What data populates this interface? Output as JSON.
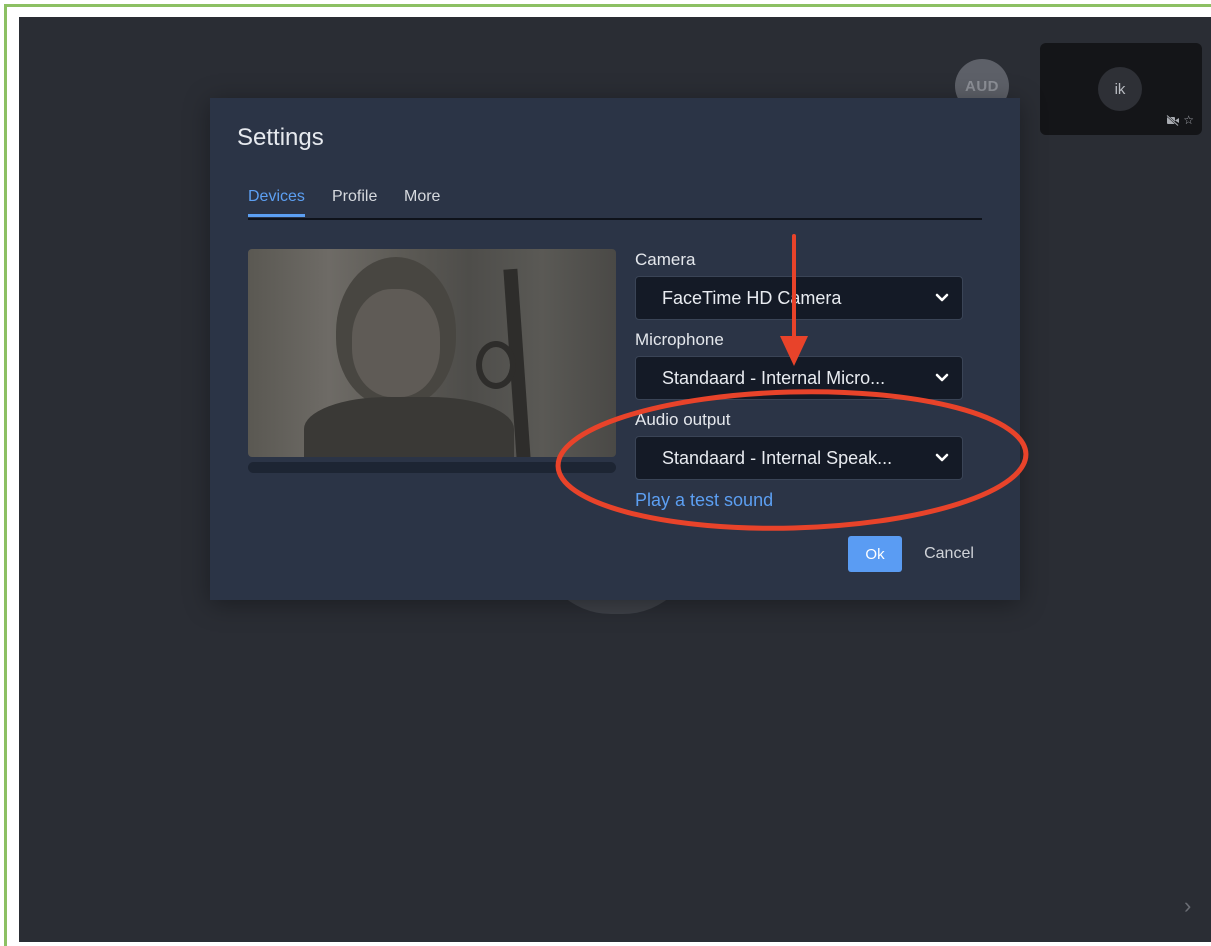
{
  "stage": {
    "remote_avatar_label": "AUD",
    "self_thumbnail": {
      "avatar_label": "ik",
      "star_icon": "☆"
    },
    "next_chevron": "›"
  },
  "settings": {
    "title": "Settings",
    "tabs": [
      {
        "label": "Devices",
        "active": true
      },
      {
        "label": "Profile",
        "active": false
      },
      {
        "label": "More",
        "active": false
      }
    ],
    "camera": {
      "label": "Camera",
      "value": "FaceTime HD Camera"
    },
    "microphone": {
      "label": "Microphone",
      "value": "Standaard - Internal Micro..."
    },
    "audio_output": {
      "label": "Audio output",
      "value": "Standaard - Internal Speak..."
    },
    "test_sound_link": "Play a test sound",
    "ok_label": "Ok",
    "cancel_label": "Cancel"
  },
  "colors": {
    "accent": "#5c9ff2",
    "annotation": "#e8432a",
    "frame_border": "#8cc063",
    "modal_bg": "#2b3446",
    "stage_bg": "#2a2d34"
  },
  "icons": {
    "select_chevron": "chevron-down-icon",
    "video_off": "video-off-icon",
    "star": "star-icon",
    "next": "chevron-right-icon"
  }
}
